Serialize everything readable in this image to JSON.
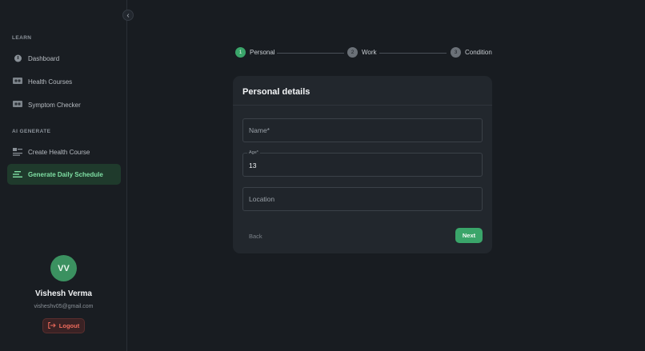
{
  "sidebar": {
    "sections": [
      {
        "label": "LEARN"
      },
      {
        "label": "AI GENERATE"
      }
    ],
    "items": [
      {
        "label": "Dashboard",
        "icon": "dashboard-icon"
      },
      {
        "label": "Health Courses",
        "icon": "courses-icon"
      },
      {
        "label": "Symptom Checker",
        "icon": "symptom-icon"
      },
      {
        "label": "Create Health Course",
        "icon": "create-course-icon"
      },
      {
        "label": "Generate Daily Schedule",
        "icon": "schedule-icon",
        "active": true
      }
    ],
    "collapse_glyph": "‹"
  },
  "user": {
    "initials": "VV",
    "name": "Vishesh Verma",
    "email": "visheshv05@gmail.com",
    "logout_label": "Logout"
  },
  "stepper": {
    "steps": [
      {
        "number": "1",
        "label": "Personal",
        "active": true
      },
      {
        "number": "2",
        "label": "Work"
      },
      {
        "number": "3",
        "label": "Condition"
      }
    ]
  },
  "form": {
    "title": "Personal details",
    "name": {
      "placeholder": "Name*",
      "value": ""
    },
    "age": {
      "label": "Age*",
      "value": "13"
    },
    "location": {
      "placeholder": "Location",
      "value": ""
    },
    "back_label": "Back",
    "next_label": "Next"
  },
  "colors": {
    "accent": "#3aa56a",
    "active_nav_bg": "#1f3a2c",
    "logout": "#ef6b5c"
  }
}
